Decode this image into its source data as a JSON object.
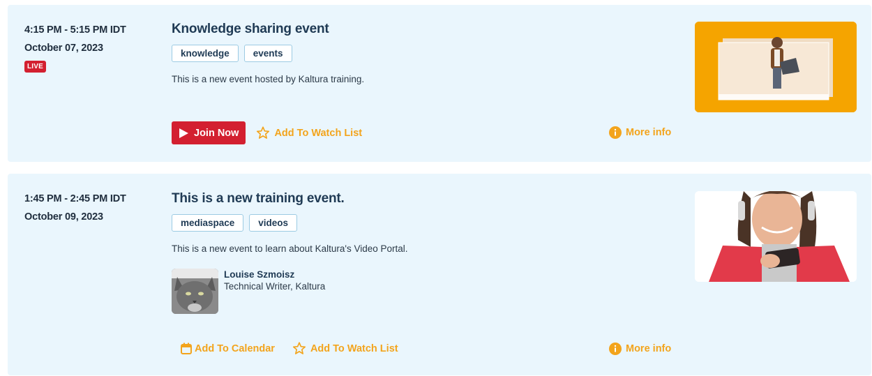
{
  "events": [
    {
      "time": "4:15 PM - 5:15 PM IDT",
      "date": "October 07, 2023",
      "live_label": "LIVE",
      "title": "Knowledge sharing event",
      "tags": [
        "knowledge",
        "events"
      ],
      "description": "This is a new event hosted by Kaltura training.",
      "join_label": "Join Now",
      "watch_label": "Add To Watch List",
      "more_label": "More info"
    },
    {
      "time": "1:45 PM - 2:45 PM IDT",
      "date": "October 09, 2023",
      "title": "This is a new training event.",
      "tags": [
        "mediaspace",
        "videos"
      ],
      "description": "This is a new event to learn about Kaltura's Video Portal.",
      "speaker": {
        "name": "Louise Szmoisz",
        "role": "Technical Writer, Kaltura"
      },
      "calendar_label": "Add To Calendar",
      "watch_label": "Add To Watch List",
      "more_label": "More info"
    }
  ],
  "colors": {
    "accent": "#f3a41c",
    "live": "#d32030",
    "card_bg": "#eaf6fd",
    "title": "#1f3a54"
  },
  "icons": [
    "play-icon",
    "star-icon",
    "info-icon",
    "calendar-icon"
  ]
}
